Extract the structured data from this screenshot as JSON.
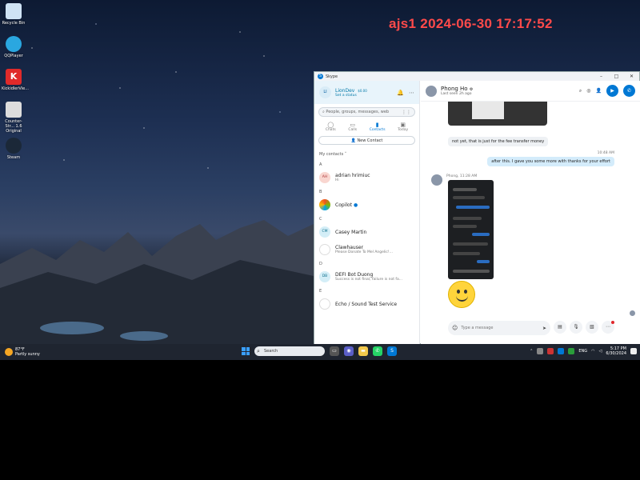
{
  "watermark": "ajs1 2024-06-30 17:17:52",
  "desktop_icons": [
    {
      "label": "Recycle Bin",
      "icon": "recycle-bin-icon"
    },
    {
      "label": "QQPlayer",
      "icon": "qqplayer-icon"
    },
    {
      "label": "KickidlerVie...",
      "icon": "kickidler-icon"
    },
    {
      "label": "Counter-Str... 1.6 Original",
      "icon": "counter-strike-icon"
    },
    {
      "label": "Steam",
      "icon": "steam-icon"
    }
  ],
  "skype": {
    "title": "Skype",
    "window_controls": {
      "minimize": "–",
      "maximize": "□",
      "close": "✕"
    },
    "profile": {
      "initials": "LI",
      "name": "LionDev",
      "credit": "$0.00",
      "status": "Set a status"
    },
    "search_placeholder": "People, groups, messages, web",
    "nav": [
      {
        "label": "Chats",
        "icon": "chat-icon"
      },
      {
        "label": "Calls",
        "icon": "calls-icon"
      },
      {
        "label": "Contacts",
        "icon": "contacts-icon"
      },
      {
        "label": "Today",
        "icon": "today-icon"
      }
    ],
    "new_contact": "New Contact",
    "my_contacts": "My contacts",
    "groups": [
      {
        "letter": "A",
        "contacts": [
          {
            "initials": "AH",
            "name": "adrian hrimiuc",
            "sub": "Hi"
          }
        ]
      },
      {
        "letter": "B",
        "contacts": [
          {
            "initials": "",
            "name": "Copilot",
            "sub": ""
          }
        ]
      },
      {
        "letter": "C",
        "contacts": [
          {
            "initials": "CM",
            "name": "Casey Martin",
            "sub": ""
          },
          {
            "initials": "",
            "name": "Clawhauser",
            "sub": "Please Donate To Mel Angelic!..."
          }
        ]
      },
      {
        "letter": "D",
        "contacts": [
          {
            "initials": "DB",
            "name": "DEFI Bot Duong",
            "sub": "Success is not final, failure is not fa..."
          }
        ]
      },
      {
        "letter": "E",
        "contacts": [
          {
            "initials": "",
            "name": "Echo / Sound Test Service",
            "sub": ""
          }
        ]
      }
    ],
    "chat": {
      "name": "Phong Ho",
      "last_seen": "Last seen 2h ago",
      "msg_in_1": "not yet, that is just for the fee transfer money",
      "time_out": "10:48 AM",
      "msg_out_1": "after this. I gave you some more with thanks for your effort",
      "meta_in_2": "Phong, 11:28 AM",
      "composer_placeholder": "Type a message"
    }
  },
  "taskbar": {
    "weather_temp": "87°F",
    "weather_desc": "Partly sunny",
    "search_placeholder": "Search",
    "lang": "ENG",
    "time": "5:17 PM",
    "date": "6/30/2024"
  },
  "colors": {
    "accent": "#0078d4",
    "watermark": "#ff4a4a",
    "taskbar": "#1f2530"
  }
}
